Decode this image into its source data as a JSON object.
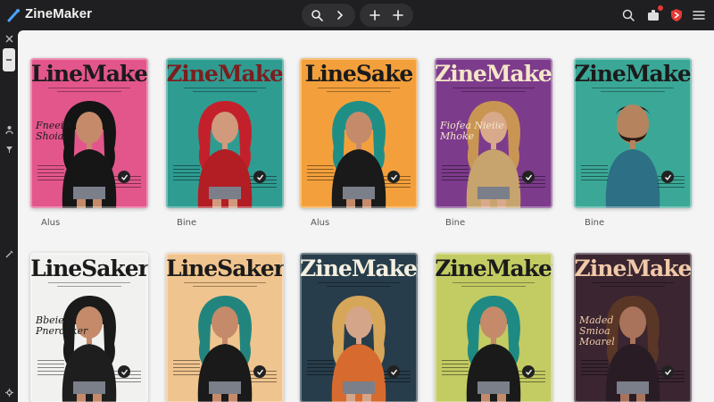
{
  "app": {
    "title": "ZineMaker"
  },
  "toolbar": {
    "search_icon": "search-icon",
    "forward_icon": "chevron-right-icon",
    "add_icon": "plus-icon"
  },
  "header_right": [
    "search-icon",
    "extension-icon",
    "profile-badge-icon",
    "menu-icon"
  ],
  "rail": [
    "close-icon",
    "drag-handle",
    "person-icon",
    "filter-icon",
    "tool-icon",
    "settings-icon"
  ],
  "colors": {
    "bg": "#1f1f21",
    "canvas": "#f4f4f4",
    "accent_red": "#e53935"
  },
  "cards": [
    {
      "title": "LineMake",
      "label": "Alus",
      "bg": "#e3568c",
      "fg": "#1b1b1b",
      "hair": "#141414",
      "top": "#161616",
      "skin": "#c48a6a",
      "cover_text": "Fneeiw Shoial"
    },
    {
      "title": "ZineMaker",
      "label": "Bine",
      "bg": "#2f9c92",
      "fg": "#7a1f1f",
      "hair": "#c4202b",
      "top": "#b31d24",
      "skin": "#d19a7d",
      "cover_text": ""
    },
    {
      "title": "LineSake",
      "label": "Alus",
      "bg": "#f3a03c",
      "fg": "#1b1b1b",
      "hair": "#1f8f86",
      "top": "#1a1a1a",
      "skin": "#c48a6a",
      "cover_text": ""
    },
    {
      "title": "ZineMaker",
      "label": "Bine",
      "bg": "#7d3b8c",
      "fg": "#f4e6c8",
      "hair": "#c99553",
      "top": "#c7a36e",
      "skin": "#d8a98a",
      "cover_text": "Fiofea Nieiie Mhoke"
    },
    {
      "title": "ZineMaker",
      "label": "Bine",
      "bg": "#3ba897",
      "fg": "#1b1b1b",
      "hair": "#1a1a1a",
      "top": "#2d6f84",
      "skin": "#b5835e",
      "cover_text": ""
    },
    {
      "title": "LineSaker",
      "label": "",
      "bg": "#f1f1ef",
      "fg": "#1b1b1b",
      "hair": "#1a1a1a",
      "top": "#1e1e1e",
      "skin": "#c48a6a",
      "cover_text": "Bbeier Pnerdaker"
    },
    {
      "title": "LineSaker",
      "label": "",
      "bg": "#f0c48e",
      "fg": "#1b1b1b",
      "hair": "#22857d",
      "top": "#1a1a1a",
      "skin": "#c48a6a",
      "cover_text": ""
    },
    {
      "title": "ZineMaker",
      "label": "",
      "bg": "#273d4b",
      "fg": "#f4f0e0",
      "hair": "#d6a65a",
      "top": "#d76b2f",
      "skin": "#d5a58a",
      "cover_text": ""
    },
    {
      "title": "ZineMaker",
      "label": "",
      "bg": "#c3cb63",
      "fg": "#1b1b1b",
      "hair": "#1e8a83",
      "top": "#1a1a1a",
      "skin": "#c48a6a",
      "cover_text": ""
    },
    {
      "title": "ZineMake",
      "label": "",
      "bg": "#3a2530",
      "fg": "#f0c9a8",
      "hair": "#5a3626",
      "top": "#2a1c24",
      "skin": "#a8735a",
      "cover_text": "Maded Smioa Moarel"
    }
  ]
}
